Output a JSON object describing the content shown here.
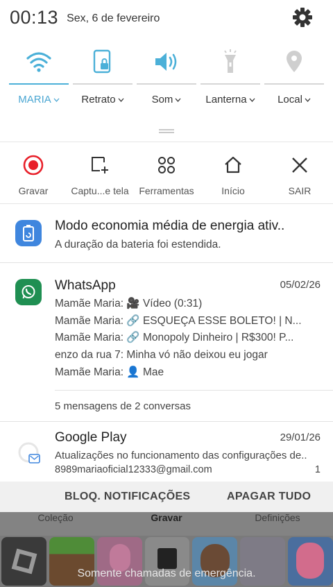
{
  "status_bar": {
    "time": "00:13",
    "date": "Sex, 6 de fevereiro"
  },
  "quick_toggles": [
    {
      "label": "MARIA",
      "icon": "wifi-icon",
      "active": true
    },
    {
      "label": "Retrato",
      "icon": "rotation-lock-icon",
      "active": true
    },
    {
      "label": "Som",
      "icon": "volume-icon",
      "active": true
    },
    {
      "label": "Lanterna",
      "icon": "flashlight-icon",
      "active": false
    },
    {
      "label": "Local",
      "icon": "location-icon",
      "active": false
    }
  ],
  "tools": [
    {
      "label": "Gravar",
      "icon": "record-icon"
    },
    {
      "label": "Captu...e tela",
      "icon": "screenshot-icon"
    },
    {
      "label": "Ferramentas",
      "icon": "tools-grid-icon"
    },
    {
      "label": "Início",
      "icon": "home-icon"
    },
    {
      "label": "SAIR",
      "icon": "close-icon"
    }
  ],
  "notifications": {
    "battery": {
      "title": "Modo economia média de energia ativ..",
      "text": "A duração da bateria foi estendida."
    },
    "whatsapp": {
      "app": "WhatsApp",
      "date": "05/02/26",
      "lines": [
        "Mamãe Maria: 🎥 Vídeo (0:31)",
        "Mamãe Maria: 🔗 ESQUEÇA ESSE BOLETO! | N...",
        "Mamãe Maria: 🔗 Monopoly Dinheiro | R$300! P...",
        "enzo da rua 7: Minha vó não deixou eu jogar",
        "Mamãe Maria: 👤 Mae"
      ],
      "summary": "5 mensagens de 2 conversas"
    },
    "google_play": {
      "app": "Google Play",
      "date": "29/01/26",
      "text": "Atualizações no funcionamento das configurações de..",
      "account": "8989mariaoficial12333@gmail.com",
      "count": "1"
    }
  },
  "actions": {
    "block": "BLOQ. NOTIFICAÇÕES",
    "clear": "APAGAR TUDO"
  },
  "background_app": {
    "tabs": [
      "Coleção",
      "Gravar",
      "Definições"
    ],
    "emergency_text": "Somente chamadas de emergência."
  },
  "colors": {
    "accent": "#4aa6d2",
    "record_red": "#e8202a",
    "whatsapp_green": "#1f8f52",
    "battery_blue": "#3f86de"
  }
}
